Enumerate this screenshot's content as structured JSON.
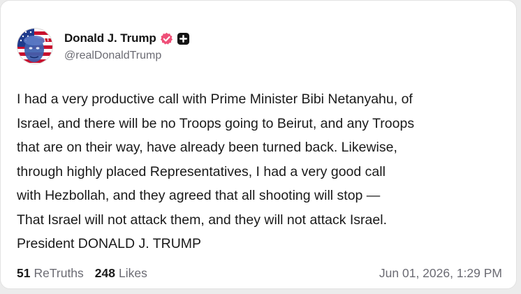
{
  "author": {
    "display_name": "Donald J. Trump",
    "handle": "@realDonaldTrump",
    "verified_icon": "verified-badge-icon",
    "plus_icon": "plus-badge-icon",
    "verified_color": "#ef4f78"
  },
  "post": {
    "lines": [
      "I had a very productive call with Prime Minister Bibi Netanyahu, of",
      "Israel, and there will be no Troops going to Beirut, and any Troops",
      "that are on their way, have already been turned back. Likewise,",
      "through highly placed Representatives, I had a very good call",
      "with Hezbollah, and they agreed that all shooting will stop —",
      "That Israel will not attack them, and they will not attack Israel.",
      "President DONALD J. TRUMP"
    ]
  },
  "stats": {
    "retruths_count": "51",
    "retruths_label": "ReTruths",
    "likes_count": "248",
    "likes_label": "Likes"
  },
  "timestamp": "Jun 01, 2026, 1:29 PM"
}
